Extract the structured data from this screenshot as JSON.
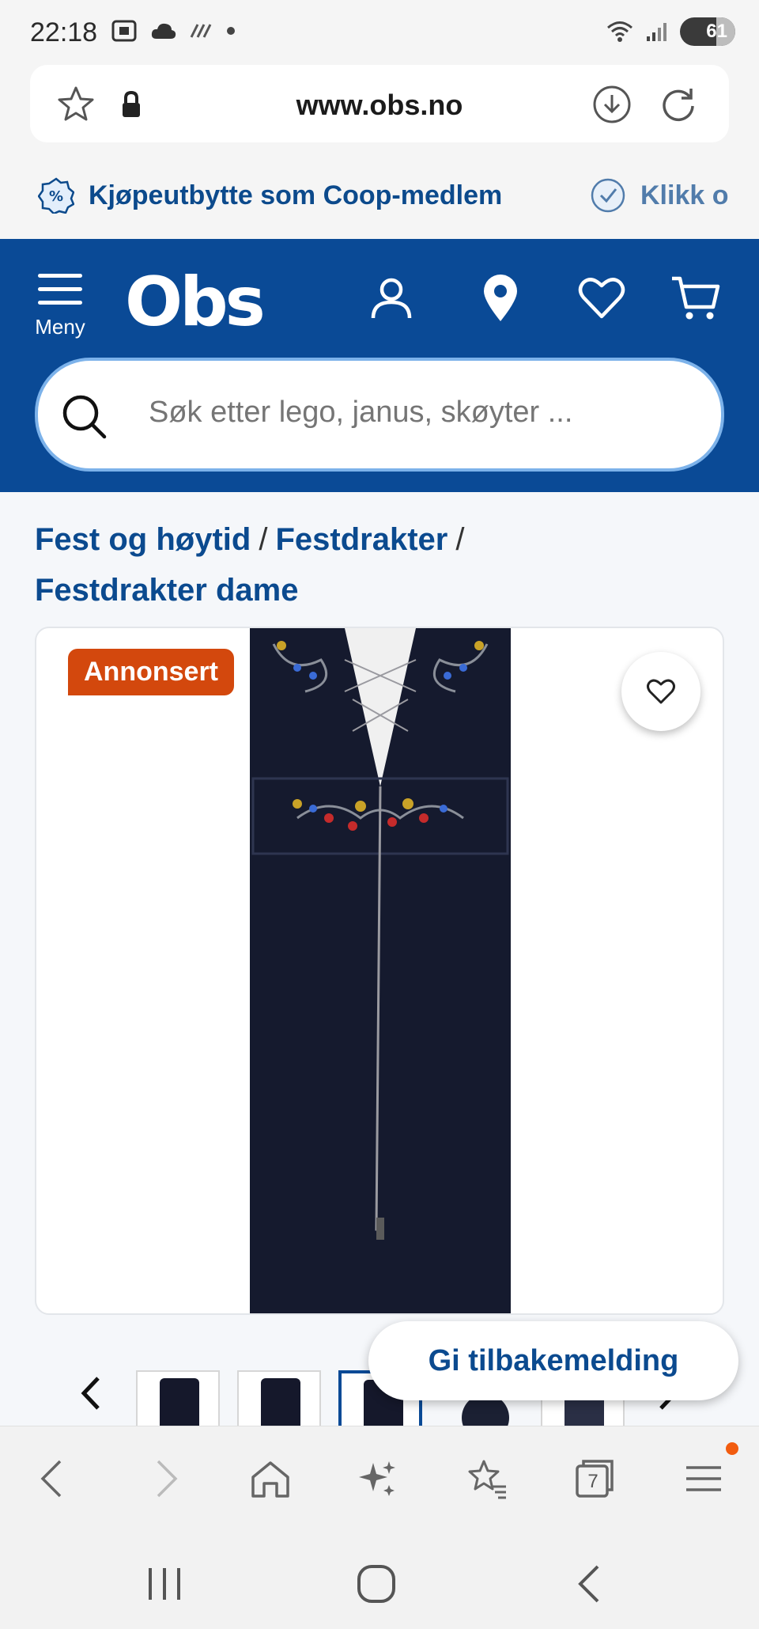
{
  "status_bar": {
    "time": "22:18",
    "battery": "61",
    "icons": [
      "screenshot-icon",
      "cloud-icon",
      "data-icon",
      "dot-icon",
      "wifi-icon",
      "signal-icon"
    ]
  },
  "browser": {
    "url": "www.obs.no",
    "tab_count": "7"
  },
  "promo": {
    "items": [
      {
        "label": "Kjøpeutbytte som Coop-medlem",
        "icon": "percent-badge-icon"
      },
      {
        "label": "Klikk o",
        "icon": "check-badge-icon"
      }
    ]
  },
  "header": {
    "menu_label": "Meny",
    "logo_text": "Obs",
    "search_placeholder": "Søk etter lego, janus, skøyter ..."
  },
  "breadcrumb": {
    "items": [
      "Fest og høytid",
      "Festdrakter",
      "Festdrakter dame"
    ],
    "separator": "/"
  },
  "product": {
    "badge": "Annonsert",
    "thumbnail_count": 5,
    "active_thumbnail": 3
  },
  "feedback_button": "Gi tilbakemelding",
  "colors": {
    "brand_blue": "#0a4a96",
    "badge_orange": "#d3480d",
    "link_blue": "#0b4a8f"
  }
}
